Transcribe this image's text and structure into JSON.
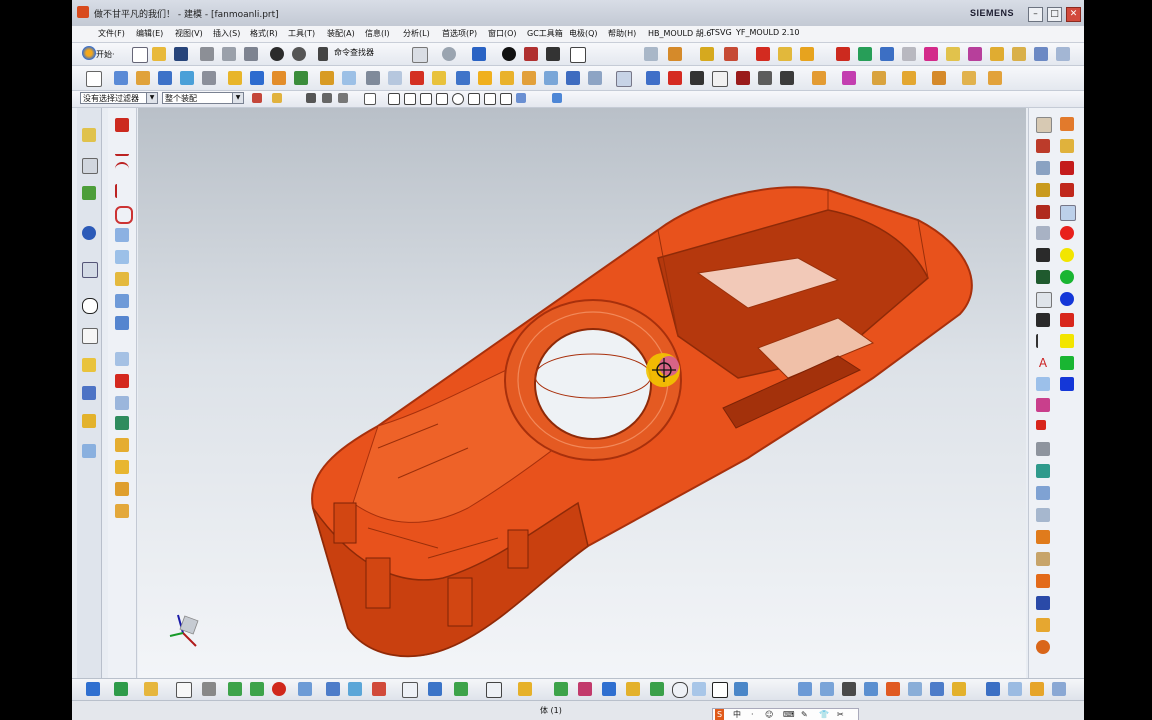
{
  "window": {
    "title": "做不甘平凡的我们！ - 建模 - [fanmoanli.prt]",
    "brand": "SIEMENS",
    "controls": [
      "–",
      "□",
      "✕"
    ]
  },
  "menu": [
    "文件(F)",
    "编辑(E)",
    "视图(V)",
    "插入(S)",
    "格式(R)",
    "工具(T)",
    "装配(A)",
    "信息(I)",
    "分析(L)",
    "首选项(P)",
    "窗口(O)",
    "GC工具箱",
    "电极(Q)",
    "帮助(H)",
    "HB_MOULD 胡.6",
    "TSVG",
    "YF_MOULD 2.10"
  ],
  "toolbar": {
    "start_label": "开始·",
    "command_finder_label": "命令查找器"
  },
  "selection_bar": {
    "filter_value": "没有选择过滤器",
    "scope_value": "整个装配"
  },
  "status": {
    "center_text": "体 (1)"
  },
  "ime_bar": [
    "S",
    "中",
    "·",
    "☺",
    "⌨",
    "✎",
    "👕",
    "✂"
  ],
  "model": {
    "name": "orange-housing-part",
    "color": "#e8521c",
    "highlight": "#f2c400"
  },
  "colors": {
    "accent": "#e8521c",
    "palette": [
      "#e8201c",
      "#f2e500",
      "#19b532",
      "#1437d8",
      "#d8261c",
      "#f2e500",
      "#19b532",
      "#1437d8"
    ]
  }
}
